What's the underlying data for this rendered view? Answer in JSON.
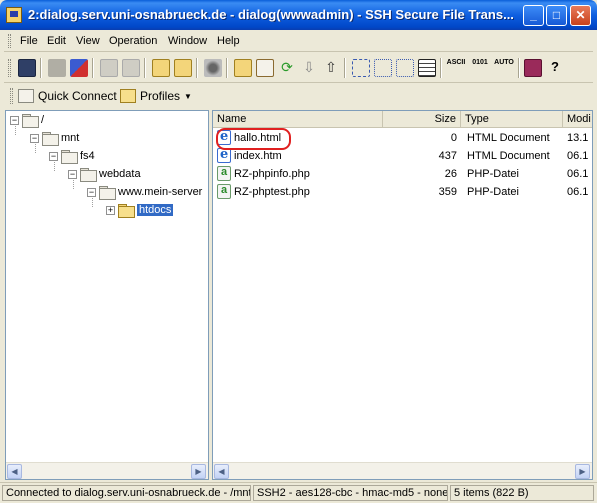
{
  "window": {
    "title": "2:dialog.serv.uni-osnabrueck.de - dialog(wwwadmin) - SSH Secure File Trans...",
    "min_glyph": "_",
    "max_glyph": "□",
    "close_glyph": "✕"
  },
  "menu": [
    "File",
    "Edit",
    "View",
    "Operation",
    "Window",
    "Help"
  ],
  "toolbar": {
    "ascii_label": "ASCII",
    "binary_label": "0101",
    "auto_label": "AUTO",
    "help_glyph": "?"
  },
  "quickbar": {
    "quick_connect": "Quick Connect",
    "profiles": "Profiles"
  },
  "tree": {
    "nodes": [
      {
        "label": "/",
        "expander": "−"
      },
      {
        "label": "mnt",
        "expander": "−"
      },
      {
        "label": "fs4",
        "expander": "−"
      },
      {
        "label": "webdata",
        "expander": "−"
      },
      {
        "label": "www.mein-server",
        "expander": "−"
      },
      {
        "label": "htdocs",
        "expander": "+"
      }
    ]
  },
  "files": {
    "columns": [
      "Name",
      "Size",
      "Type",
      "Modi"
    ],
    "rows": [
      {
        "name": "hallo.html",
        "size": "0",
        "type": "HTML Document",
        "modified": "13.1",
        "kind": "html"
      },
      {
        "name": "index.htm",
        "size": "437",
        "type": "HTML Document",
        "modified": "06.1",
        "kind": "html"
      },
      {
        "name": "RZ-phpinfo.php",
        "size": "26",
        "type": "PHP-Datei",
        "modified": "06.1",
        "kind": "php"
      },
      {
        "name": "RZ-phptest.php",
        "size": "359",
        "type": "PHP-Datei",
        "modified": "06.1",
        "kind": "php"
      }
    ]
  },
  "status": {
    "connection": "Connected to dialog.serv.uni-osnabrueck.de - /mnt",
    "cipher": "SSH2 - aes128-cbc - hmac-md5 - none",
    "items": "5 items (822 B)"
  },
  "colors": {
    "titlebar": "#0f5fe0",
    "selection": "#316ac5",
    "highlight_ring": "#e02020"
  }
}
